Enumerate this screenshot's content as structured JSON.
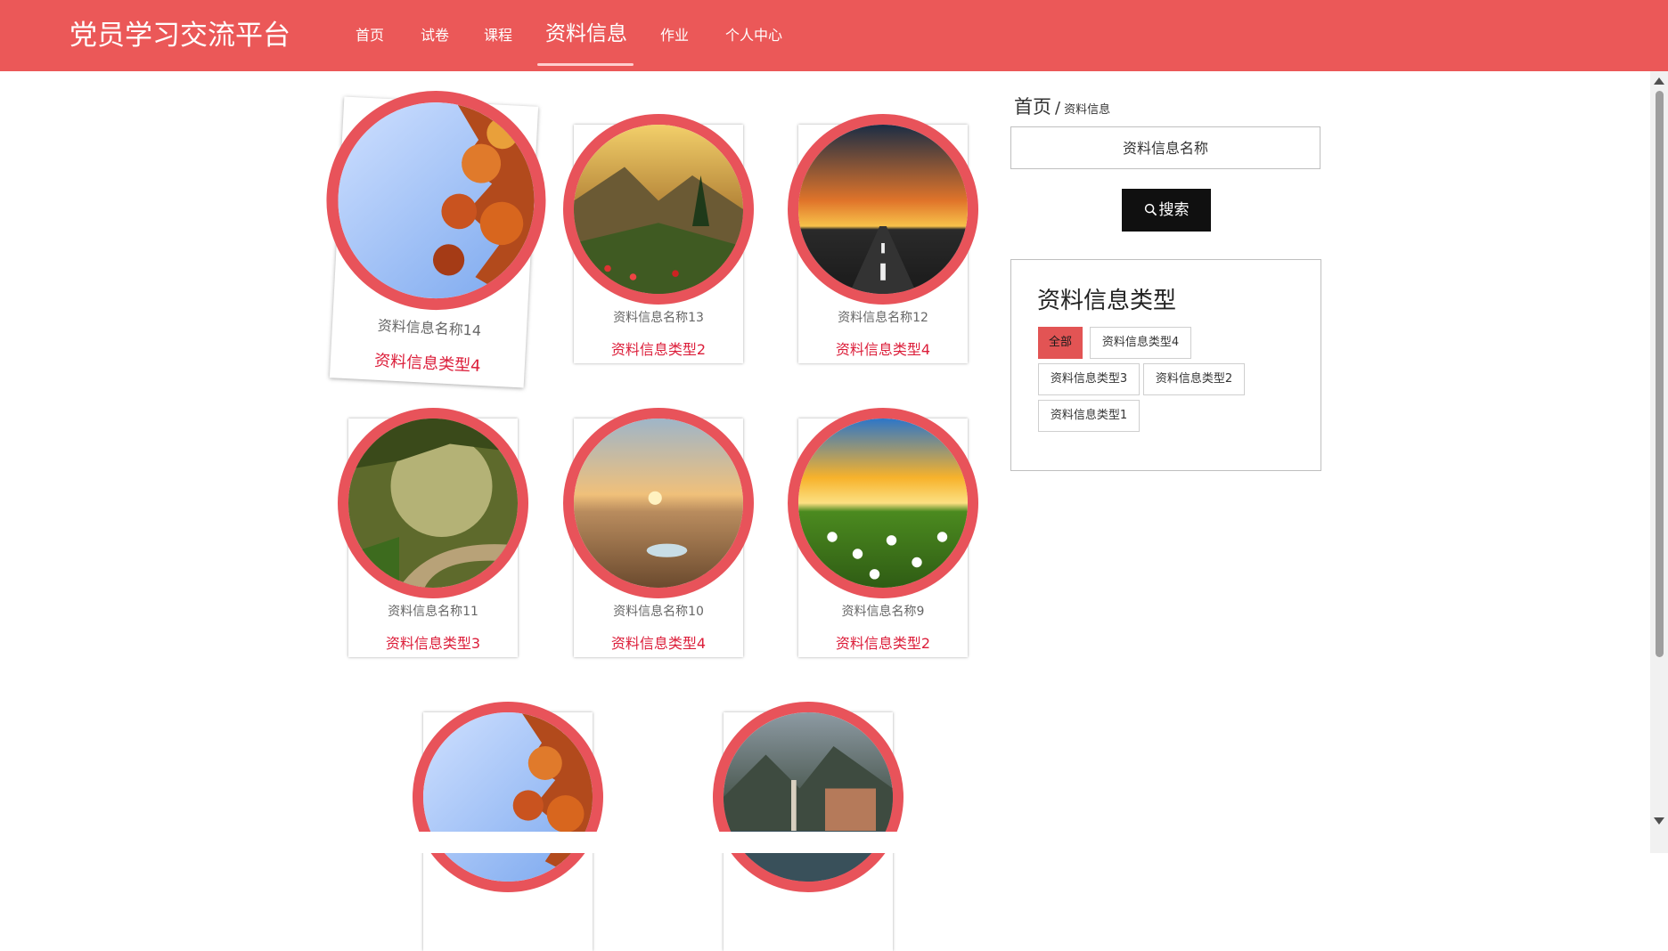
{
  "header": {
    "brand": "党员学习交流平台",
    "nav": [
      "首页",
      "试卷",
      "课程",
      "资料信息",
      "作业",
      "个人中心"
    ],
    "active_nav": "资料信息",
    "color": "#eb5858"
  },
  "cards": [
    {
      "name": "资料信息名称14",
      "type": "资料信息类型4",
      "image": "autumn-leaves-sky",
      "hovered": true
    },
    {
      "name": "资料信息名称13",
      "type": "资料信息类型2",
      "image": "mountain-valley-sunset"
    },
    {
      "name": "资料信息名称12",
      "type": "资料信息类型4",
      "image": "road-sunset"
    },
    {
      "name": "资料信息名称11",
      "type": "资料信息类型3",
      "image": "forest-path-mist"
    },
    {
      "name": "资料信息名称10",
      "type": "资料信息类型4",
      "image": "desert-oasis-sunrise"
    },
    {
      "name": "资料信息名称9",
      "type": "资料信息类型2",
      "image": "daisy-field-sun"
    },
    {
      "name": "",
      "type": "",
      "image": "autumn-leaves-sky"
    },
    {
      "name": "",
      "type": "",
      "image": "lakeside-village-mountains"
    }
  ],
  "breadcrumb": {
    "home": "首页",
    "separator": "/",
    "current": "资料信息"
  },
  "search": {
    "placeholder": "资料信息名称",
    "button_label": "搜索",
    "button_icon": "search-icon"
  },
  "type_filter": {
    "title": "资料信息类型",
    "tags": [
      "全部",
      "资料信息类型4",
      "资料信息类型3",
      "资料信息类型2",
      "资料信息类型1"
    ],
    "active": "全部",
    "accent": "#e25454"
  }
}
